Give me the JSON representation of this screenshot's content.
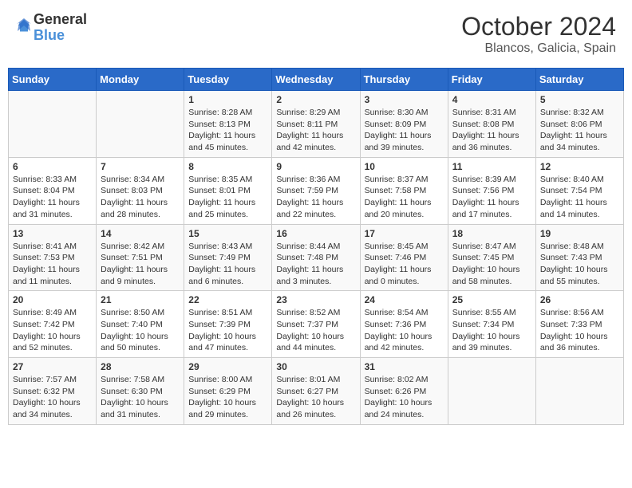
{
  "header": {
    "logo_line1": "General",
    "logo_line2": "Blue",
    "month": "October 2024",
    "location": "Blancos, Galicia, Spain"
  },
  "days_of_week": [
    "Sunday",
    "Monday",
    "Tuesday",
    "Wednesday",
    "Thursday",
    "Friday",
    "Saturday"
  ],
  "weeks": [
    [
      {
        "day": "",
        "info": ""
      },
      {
        "day": "",
        "info": ""
      },
      {
        "day": "1",
        "info": "Sunrise: 8:28 AM\nSunset: 8:13 PM\nDaylight: 11 hours and 45 minutes."
      },
      {
        "day": "2",
        "info": "Sunrise: 8:29 AM\nSunset: 8:11 PM\nDaylight: 11 hours and 42 minutes."
      },
      {
        "day": "3",
        "info": "Sunrise: 8:30 AM\nSunset: 8:09 PM\nDaylight: 11 hours and 39 minutes."
      },
      {
        "day": "4",
        "info": "Sunrise: 8:31 AM\nSunset: 8:08 PM\nDaylight: 11 hours and 36 minutes."
      },
      {
        "day": "5",
        "info": "Sunrise: 8:32 AM\nSunset: 8:06 PM\nDaylight: 11 hours and 34 minutes."
      }
    ],
    [
      {
        "day": "6",
        "info": "Sunrise: 8:33 AM\nSunset: 8:04 PM\nDaylight: 11 hours and 31 minutes."
      },
      {
        "day": "7",
        "info": "Sunrise: 8:34 AM\nSunset: 8:03 PM\nDaylight: 11 hours and 28 minutes."
      },
      {
        "day": "8",
        "info": "Sunrise: 8:35 AM\nSunset: 8:01 PM\nDaylight: 11 hours and 25 minutes."
      },
      {
        "day": "9",
        "info": "Sunrise: 8:36 AM\nSunset: 7:59 PM\nDaylight: 11 hours and 22 minutes."
      },
      {
        "day": "10",
        "info": "Sunrise: 8:37 AM\nSunset: 7:58 PM\nDaylight: 11 hours and 20 minutes."
      },
      {
        "day": "11",
        "info": "Sunrise: 8:39 AM\nSunset: 7:56 PM\nDaylight: 11 hours and 17 minutes."
      },
      {
        "day": "12",
        "info": "Sunrise: 8:40 AM\nSunset: 7:54 PM\nDaylight: 11 hours and 14 minutes."
      }
    ],
    [
      {
        "day": "13",
        "info": "Sunrise: 8:41 AM\nSunset: 7:53 PM\nDaylight: 11 hours and 11 minutes."
      },
      {
        "day": "14",
        "info": "Sunrise: 8:42 AM\nSunset: 7:51 PM\nDaylight: 11 hours and 9 minutes."
      },
      {
        "day": "15",
        "info": "Sunrise: 8:43 AM\nSunset: 7:49 PM\nDaylight: 11 hours and 6 minutes."
      },
      {
        "day": "16",
        "info": "Sunrise: 8:44 AM\nSunset: 7:48 PM\nDaylight: 11 hours and 3 minutes."
      },
      {
        "day": "17",
        "info": "Sunrise: 8:45 AM\nSunset: 7:46 PM\nDaylight: 11 hours and 0 minutes."
      },
      {
        "day": "18",
        "info": "Sunrise: 8:47 AM\nSunset: 7:45 PM\nDaylight: 10 hours and 58 minutes."
      },
      {
        "day": "19",
        "info": "Sunrise: 8:48 AM\nSunset: 7:43 PM\nDaylight: 10 hours and 55 minutes."
      }
    ],
    [
      {
        "day": "20",
        "info": "Sunrise: 8:49 AM\nSunset: 7:42 PM\nDaylight: 10 hours and 52 minutes."
      },
      {
        "day": "21",
        "info": "Sunrise: 8:50 AM\nSunset: 7:40 PM\nDaylight: 10 hours and 50 minutes."
      },
      {
        "day": "22",
        "info": "Sunrise: 8:51 AM\nSunset: 7:39 PM\nDaylight: 10 hours and 47 minutes."
      },
      {
        "day": "23",
        "info": "Sunrise: 8:52 AM\nSunset: 7:37 PM\nDaylight: 10 hours and 44 minutes."
      },
      {
        "day": "24",
        "info": "Sunrise: 8:54 AM\nSunset: 7:36 PM\nDaylight: 10 hours and 42 minutes."
      },
      {
        "day": "25",
        "info": "Sunrise: 8:55 AM\nSunset: 7:34 PM\nDaylight: 10 hours and 39 minutes."
      },
      {
        "day": "26",
        "info": "Sunrise: 8:56 AM\nSunset: 7:33 PM\nDaylight: 10 hours and 36 minutes."
      }
    ],
    [
      {
        "day": "27",
        "info": "Sunrise: 7:57 AM\nSunset: 6:32 PM\nDaylight: 10 hours and 34 minutes."
      },
      {
        "day": "28",
        "info": "Sunrise: 7:58 AM\nSunset: 6:30 PM\nDaylight: 10 hours and 31 minutes."
      },
      {
        "day": "29",
        "info": "Sunrise: 8:00 AM\nSunset: 6:29 PM\nDaylight: 10 hours and 29 minutes."
      },
      {
        "day": "30",
        "info": "Sunrise: 8:01 AM\nSunset: 6:27 PM\nDaylight: 10 hours and 26 minutes."
      },
      {
        "day": "31",
        "info": "Sunrise: 8:02 AM\nSunset: 6:26 PM\nDaylight: 10 hours and 24 minutes."
      },
      {
        "day": "",
        "info": ""
      },
      {
        "day": "",
        "info": ""
      }
    ]
  ]
}
